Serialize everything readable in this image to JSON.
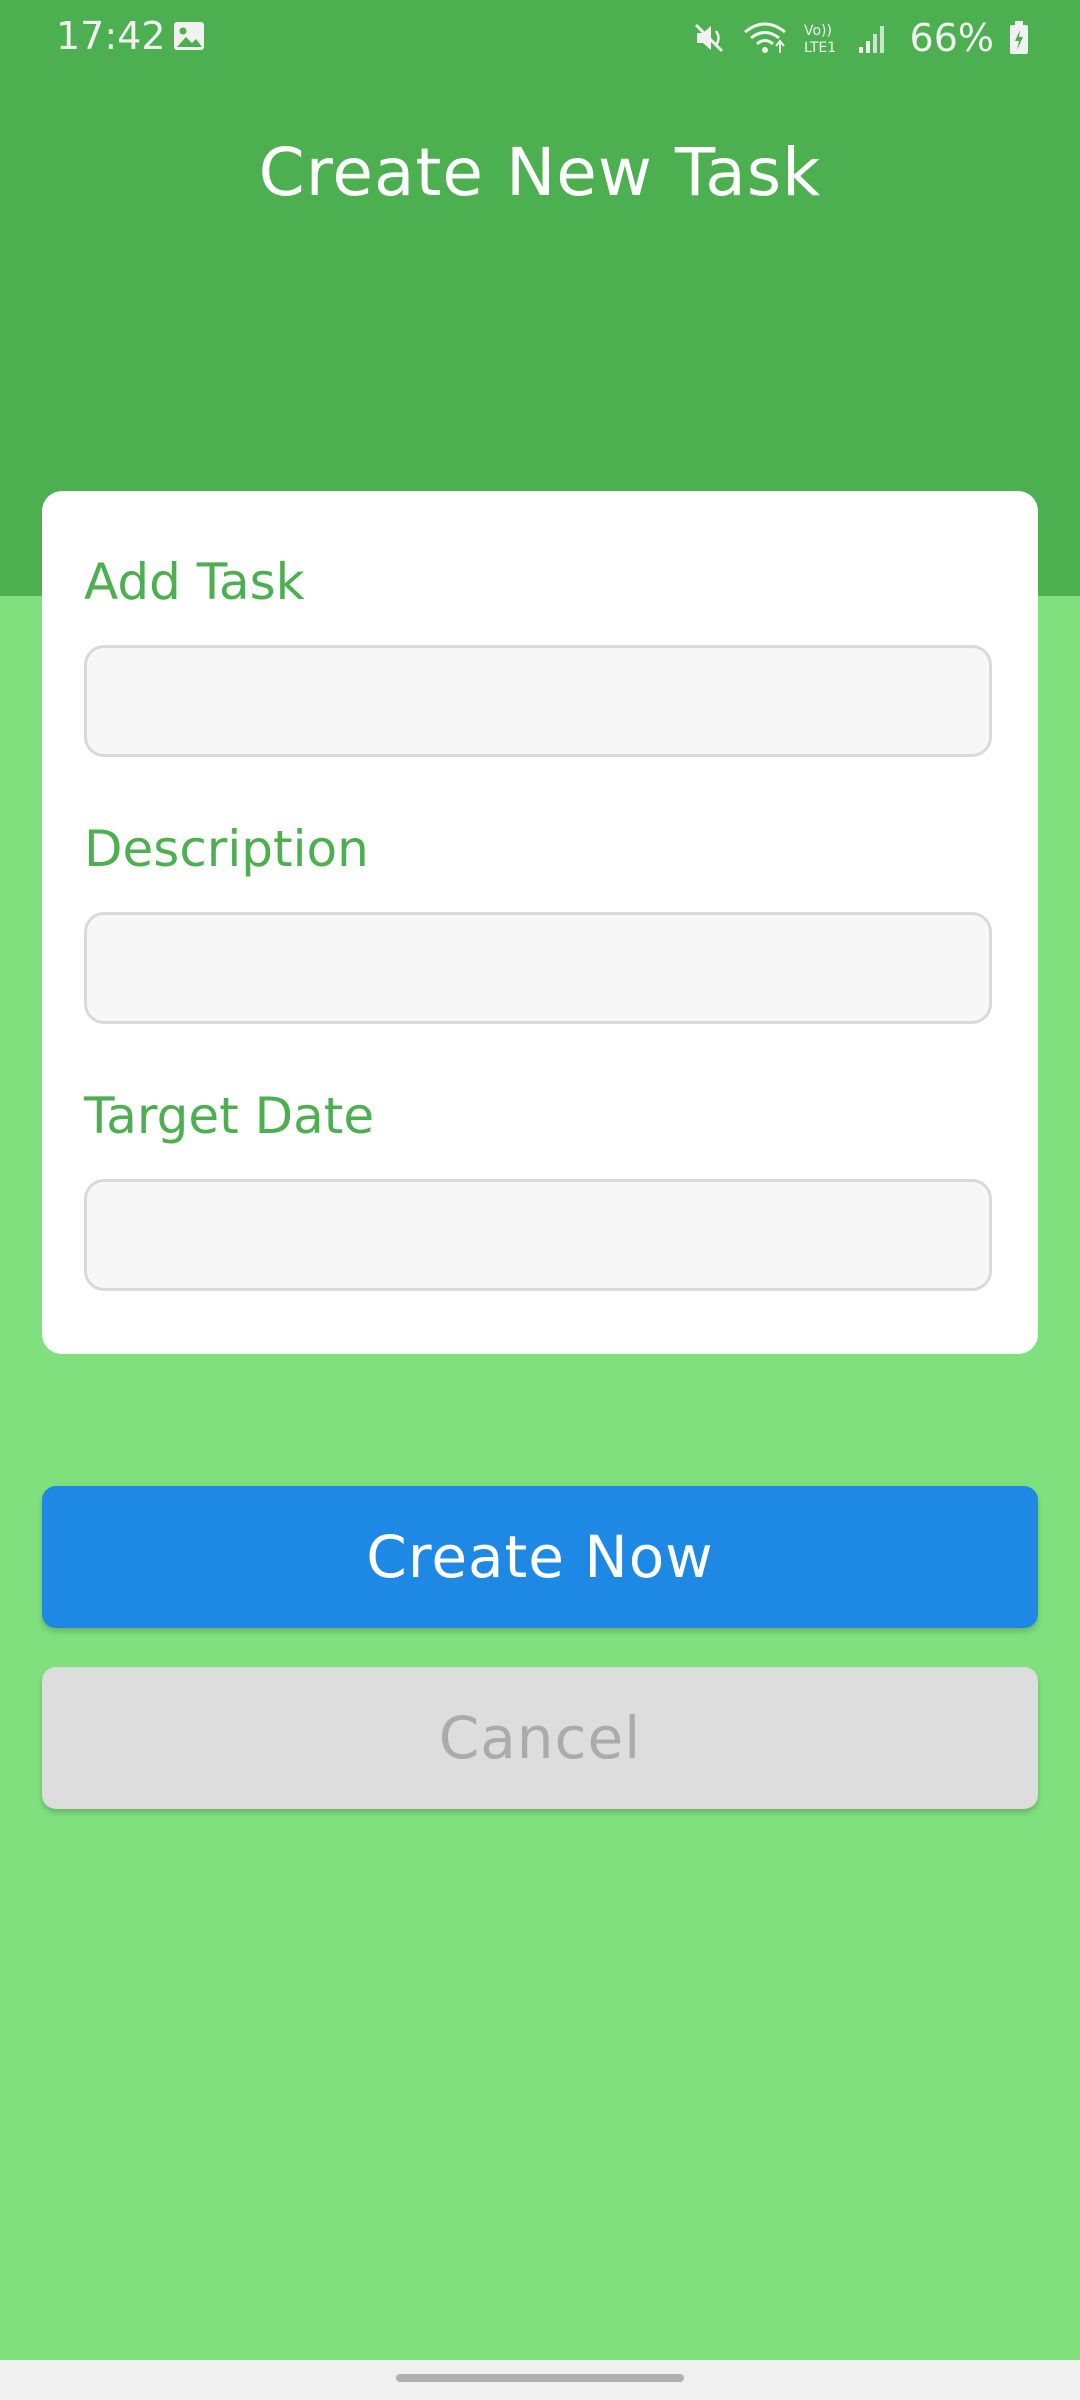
{
  "status_bar": {
    "time": "17:42",
    "battery_percent": "66%",
    "network_label": "LTE1",
    "icons": [
      "gallery-icon",
      "mute-icon",
      "wifi-icon",
      "lte-icon",
      "signal-icon",
      "battery-icon"
    ]
  },
  "header": {
    "title": "Create New Task"
  },
  "form": {
    "task_label": "Add Task",
    "task_value": "",
    "description_label": "Description",
    "description_value": "",
    "target_date_label": "Target Date",
    "target_date_value": ""
  },
  "actions": {
    "create_label": "Create Now",
    "cancel_label": "Cancel"
  },
  "colors": {
    "header_green": "#4caf50",
    "background_light_green": "#80e07e",
    "primary_blue": "#1e88e5",
    "cancel_gray": "#dddddd"
  }
}
